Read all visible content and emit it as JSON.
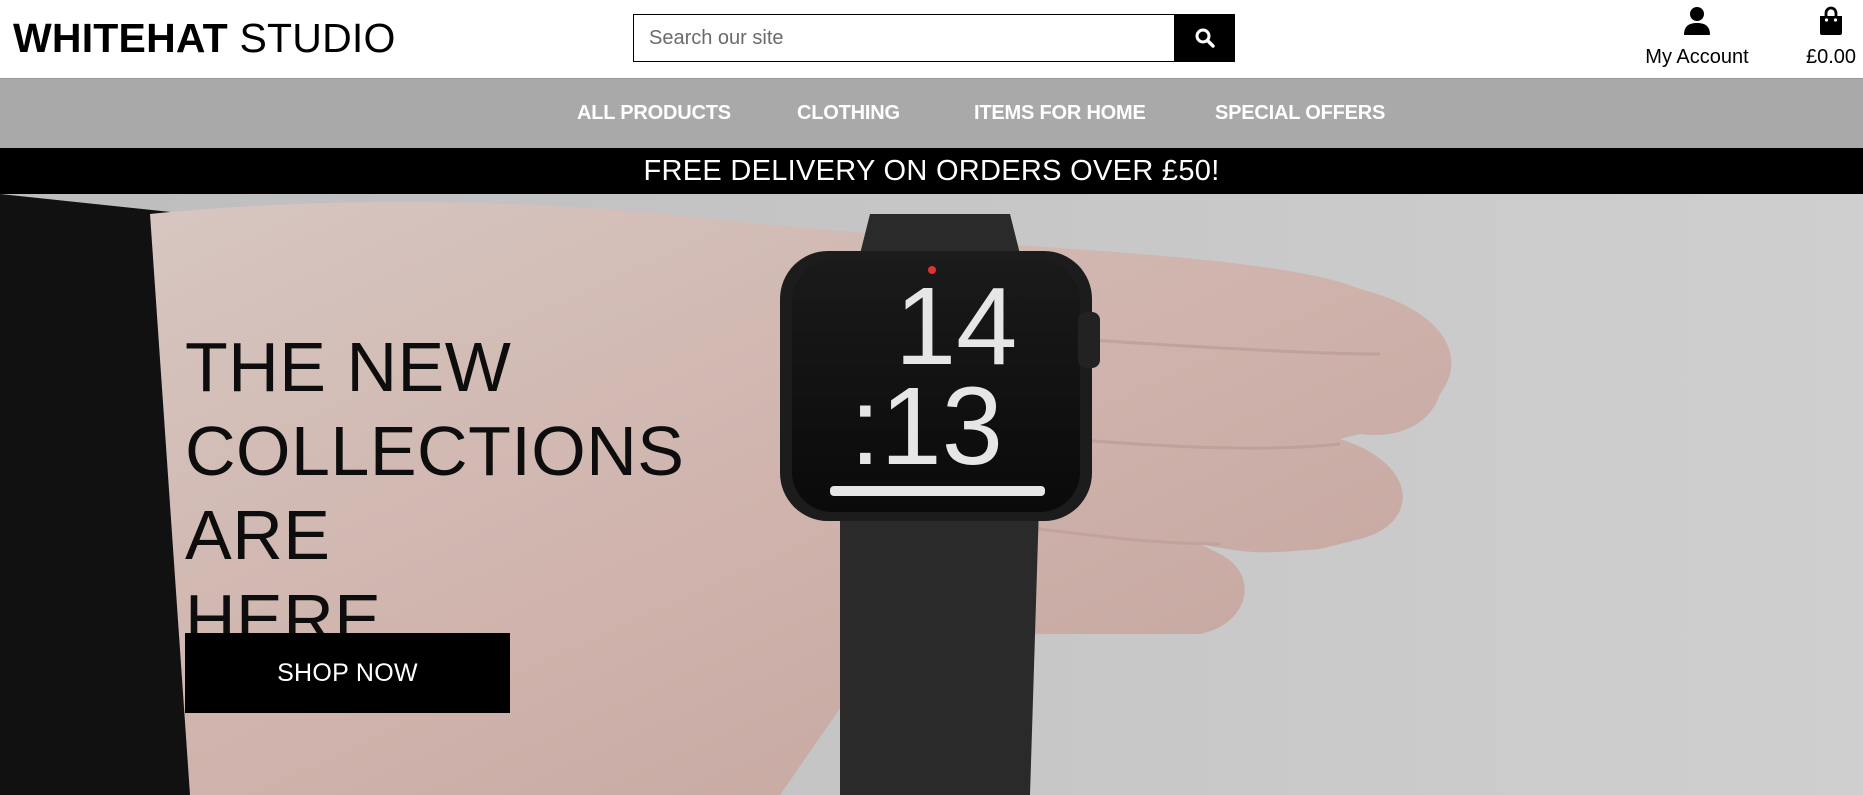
{
  "brand": {
    "bold": "WHITEHAT",
    "light": "STUDIO"
  },
  "search": {
    "placeholder": "Search our site",
    "value": "",
    "button_icon": "search-icon"
  },
  "account": {
    "label": "My Account",
    "icon": "user-icon"
  },
  "bag": {
    "total": "£0.00",
    "icon": "shopping-bag-icon"
  },
  "nav": {
    "items": [
      {
        "label": "ALL PRODUCTS"
      },
      {
        "label": "CLOTHING"
      },
      {
        "label": "ITEMS FOR HOME"
      },
      {
        "label": "SPECIAL OFFERS"
      }
    ]
  },
  "banner": {
    "text": "FREE DELIVERY ON ORDERS OVER £50!"
  },
  "hero": {
    "title_lines": [
      "THE NEW",
      "COLLECTIONS ARE",
      "HERE"
    ],
    "cta_label": "SHOP NOW",
    "watch_hours": "14",
    "watch_minutes": ":13"
  },
  "colors": {
    "header_bg": "#ffffff",
    "nav_bg": "#a9a9a9",
    "banner_bg": "#000000",
    "button_bg": "#000000",
    "text_light": "#ffffff"
  }
}
